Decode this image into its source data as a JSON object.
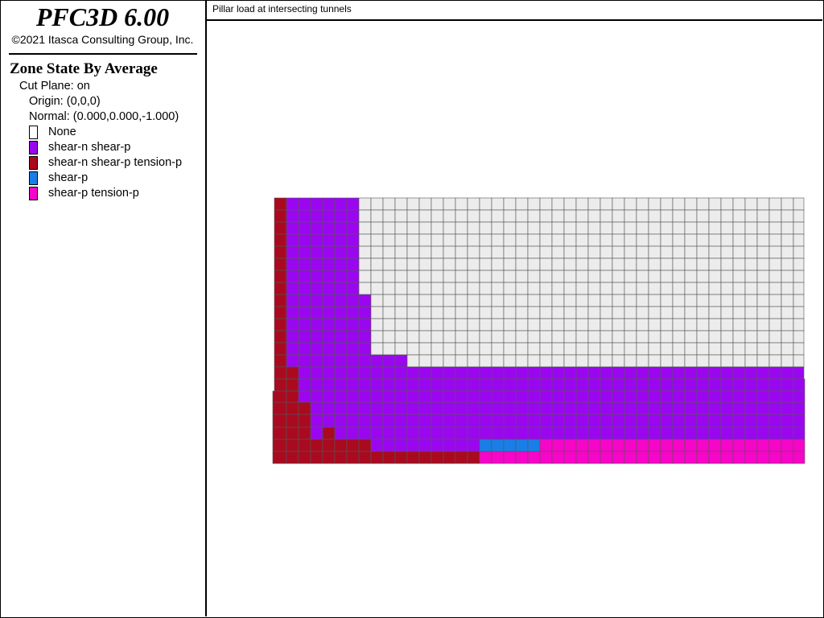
{
  "app": {
    "title": "PFC3D 6.00",
    "copyright": "©2021 Itasca Consulting Group, Inc."
  },
  "legend": {
    "heading": "Zone State By Average",
    "cut_plane": "Cut Plane: on",
    "origin": "Origin: (0,0,0)",
    "normal": "Normal: (0.000,0.000,-1.000)",
    "items": [
      {
        "label": "None",
        "color": "#ffffff"
      },
      {
        "label": "shear-n shear-p",
        "color": "#9b06f0"
      },
      {
        "label": "shear-n shear-p tension-p",
        "color": "#a90a1f"
      },
      {
        "label": "shear-p",
        "color": "#1a7ee8"
      },
      {
        "label": "shear-p tension-p",
        "color": "#f705c8"
      }
    ]
  },
  "plot": {
    "title": "Pillar load at intersecting tunnels"
  },
  "colors": {
    "none_fill": "#ececec",
    "grid_line": "#555555"
  }
}
